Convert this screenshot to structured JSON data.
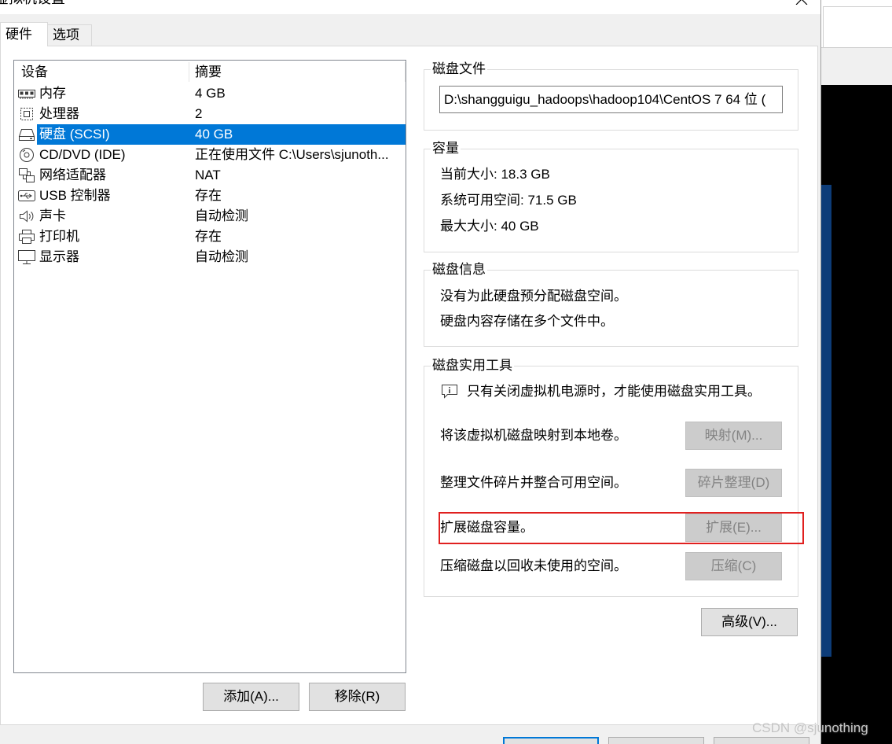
{
  "window": {
    "title": "虚拟机设置",
    "close_icon": "close-icon"
  },
  "tabs": [
    {
      "label": "硬件",
      "selected": true
    },
    {
      "label": "选项",
      "selected": false
    }
  ],
  "device_list": {
    "column_device": "设备",
    "column_summary": "摘要",
    "rows": [
      {
        "icon": "memory-icon",
        "device": "内存",
        "summary": "4 GB",
        "selected": false
      },
      {
        "icon": "processor-icon",
        "device": "处理器",
        "summary": "2",
        "selected": false
      },
      {
        "icon": "hard-disk-icon",
        "device": "硬盘 (SCSI)",
        "summary": "40 GB",
        "selected": true
      },
      {
        "icon": "cd-dvd-icon",
        "device": "CD/DVD (IDE)",
        "summary": "正在使用文件 C:\\Users\\sjunoth...",
        "selected": false
      },
      {
        "icon": "network-adapter-icon",
        "device": "网络适配器",
        "summary": "NAT",
        "selected": false
      },
      {
        "icon": "usb-icon",
        "device": "USB 控制器",
        "summary": "存在",
        "selected": false
      },
      {
        "icon": "sound-card-icon",
        "device": "声卡",
        "summary": "自动检测",
        "selected": false
      },
      {
        "icon": "printer-icon",
        "device": "打印机",
        "summary": "存在",
        "selected": false
      },
      {
        "icon": "monitor-icon",
        "device": "显示器",
        "summary": "自动检测",
        "selected": false
      }
    ],
    "add_button": "添加(A)...",
    "remove_button": "移除(R)"
  },
  "disk_file": {
    "title": "磁盘文件",
    "path": "D:\\shangguigu_hadoops\\hadoop104\\CentOS 7 64 位 ("
  },
  "capacity": {
    "title": "容量",
    "current_size": "当前大小: 18.3 GB",
    "free_space": "系统可用空间: 71.5 GB",
    "max_size": "最大大小: 40 GB"
  },
  "disk_info": {
    "title": "磁盘信息",
    "line1": "没有为此硬盘预分配磁盘空间。",
    "line2": "硬盘内容存储在多个文件中。"
  },
  "disk_utilities": {
    "title": "磁盘实用工具",
    "info_icon": "info-icon",
    "notice": "只有关闭虚拟机电源时，才能使用磁盘实用工具。",
    "actions": [
      {
        "description": "将该虚拟机磁盘映射到本地卷。",
        "button": "映射(M)...",
        "enabled": false,
        "highlighted": false
      },
      {
        "description": "整理文件碎片并整合可用空间。",
        "button": "碎片整理(D)",
        "enabled": false,
        "highlighted": false
      },
      {
        "description": "扩展磁盘容量。",
        "button": "扩展(E)...",
        "enabled": false,
        "highlighted": true
      },
      {
        "description": "压缩磁盘以回收未使用的空间。",
        "button": "压缩(C)",
        "enabled": false,
        "highlighted": false
      }
    ]
  },
  "advanced_button": "高级(V)...",
  "watermark": "CSDN @sjunothing",
  "colors": {
    "selection": "#0078d7",
    "highlight_box": "#e0201f",
    "background_window_blue": "#0d3c78"
  }
}
